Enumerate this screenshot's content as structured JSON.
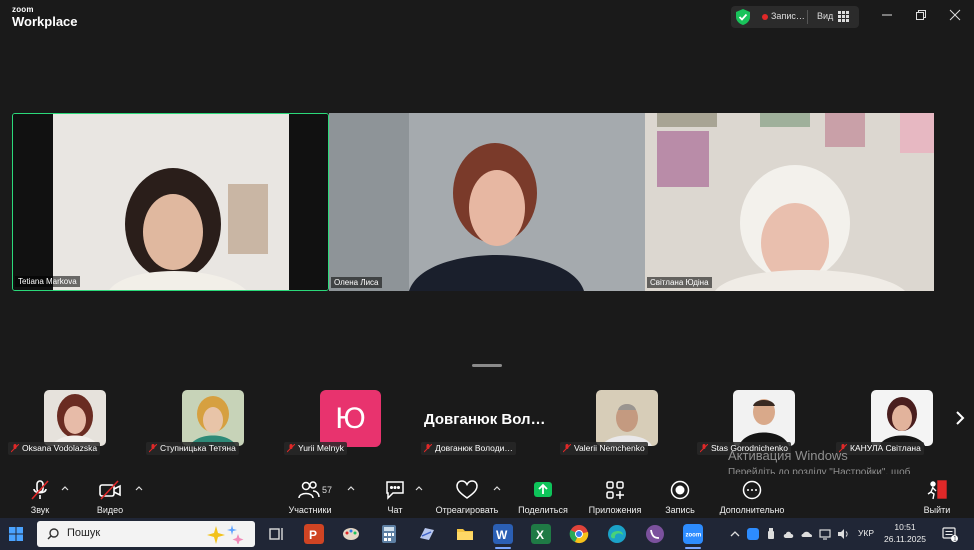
{
  "app": {
    "brand_small": "zoom",
    "brand_large": "Workplace"
  },
  "titlebar": {
    "recording_label": "Запис…",
    "view_label": "Вид"
  },
  "gallery": [
    {
      "name": "Tetiana Markova",
      "active_speaker": true
    },
    {
      "name": "Олена Лиса"
    },
    {
      "name": "Світлана Юдіна"
    }
  ],
  "thumbnails": [
    {
      "name": "Oksana Vodolazska",
      "muted": true
    },
    {
      "name": "Ступницька Тетяна",
      "muted": true
    },
    {
      "name": "Yurii Melnyk",
      "muted": true,
      "initial": "Ю"
    },
    {
      "name": "Довганюк Володи…",
      "muted": true,
      "display": "Довганюк  Вол…"
    },
    {
      "name": "Valerii Nemchenko",
      "muted": true
    },
    {
      "name": "Stas Gorodnichenko",
      "muted": true
    },
    {
      "name": "КАНУЛА Світлана",
      "muted": true
    }
  ],
  "toolbar": {
    "audio": "Звук",
    "video": "Видео",
    "participants": "Участники",
    "participants_count": "57",
    "chat": "Чат",
    "react": "Отреагировать",
    "share": "Поделиться",
    "apps": "Приложения",
    "record": "Запись",
    "more": "Дополнительно",
    "leave": "Выйти"
  },
  "activation": {
    "title": "Активация Windows",
    "text": "Перейдіть до розділу \"Настройки\", щоб активувати Windows."
  },
  "taskbar": {
    "search_placeholder": "Пошук",
    "lang": "УКР",
    "time": "10:51",
    "date": "26.11.2025",
    "notifications": "1"
  },
  "colors": {
    "accent_green": "#2bd97a",
    "share_green": "#0ec45a",
    "leave_red": "#e02828",
    "initial_pink": "#e8336e"
  }
}
